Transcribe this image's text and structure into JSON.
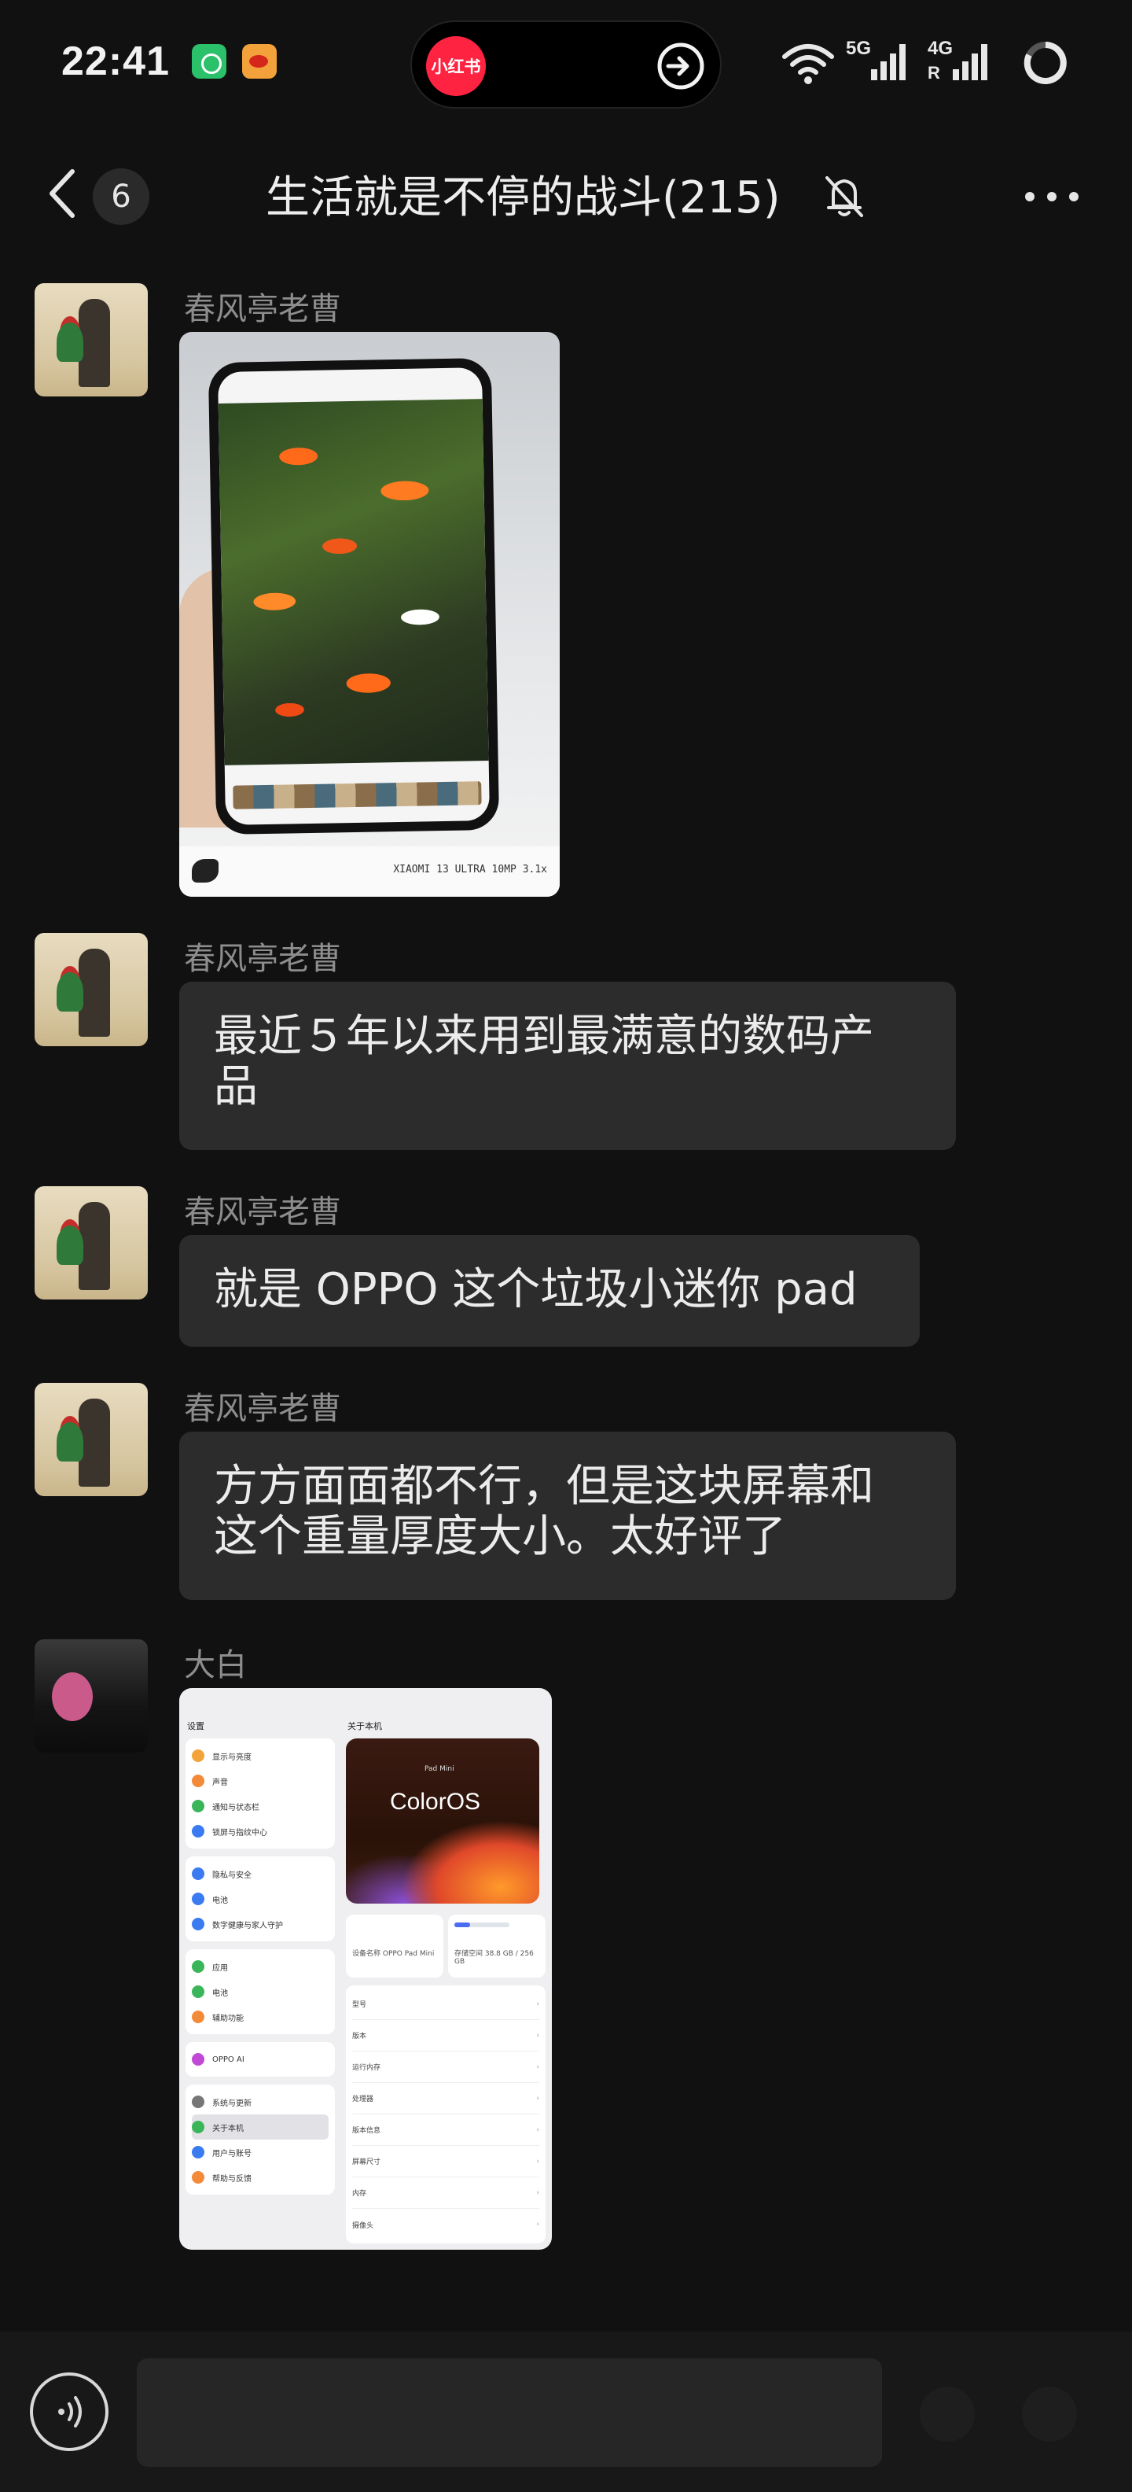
{
  "status_bar": {
    "time": "22:41",
    "island_app": "小红书",
    "network_1": "5G",
    "network_2": "4G",
    "network_2_sub": "R"
  },
  "header": {
    "unread_count": "6",
    "title": "生活就是不停的战斗(215)"
  },
  "messages": [
    {
      "sender": "春风亭老曹",
      "type": "image",
      "image_caption": "XIAOMI 13 ULTRA 10MP 3.1x"
    },
    {
      "sender": "春风亭老曹",
      "type": "text",
      "lines": [
        "最近５年以来用到最满意的数码产",
        "品"
      ]
    },
    {
      "sender": "春风亭老曹",
      "type": "text",
      "lines": [
        "就是 OPPO 这个垃圾小迷你 pad"
      ]
    },
    {
      "sender": "春风亭老曹",
      "type": "text",
      "lines": [
        "方方面面都不行，但是这块屏幕和",
        "这个重量厚度大小。太好评了"
      ]
    },
    {
      "sender": "大白",
      "type": "image",
      "screenshot": {
        "left_title": "设置",
        "right_title": "关于本机",
        "os_name": "ColorOS",
        "device_label": "Pad Mini",
        "left_groups": [
          [
            "显示与亮度",
            "声音",
            "通知与状态栏",
            "锁屏与指纹中心"
          ],
          [
            "隐私与安全",
            "电池",
            "数字健康与家人守护"
          ],
          [
            "应用",
            "电池",
            "辅助功能"
          ],
          [
            "OPPO AI"
          ],
          [
            "系统与更新",
            "关于本机",
            "用户与账号",
            "帮助与反馈"
          ]
        ],
        "cells": [
          "设备名称 OPPO Pad Mini",
          "存储空间 38.8 GB / 256 GB"
        ],
        "rows": [
          "型号",
          "版本",
          "运行内存",
          "处理器",
          "版本信息",
          "屏幕尺寸",
          "内存",
          "摄像头"
        ]
      }
    }
  ],
  "input": {
    "placeholder": ""
  },
  "colors": {
    "background": "#111111",
    "bubble": "#2c2c2c",
    "sender_name": "#8d8d8d",
    "island_logo": "#ff2342"
  }
}
